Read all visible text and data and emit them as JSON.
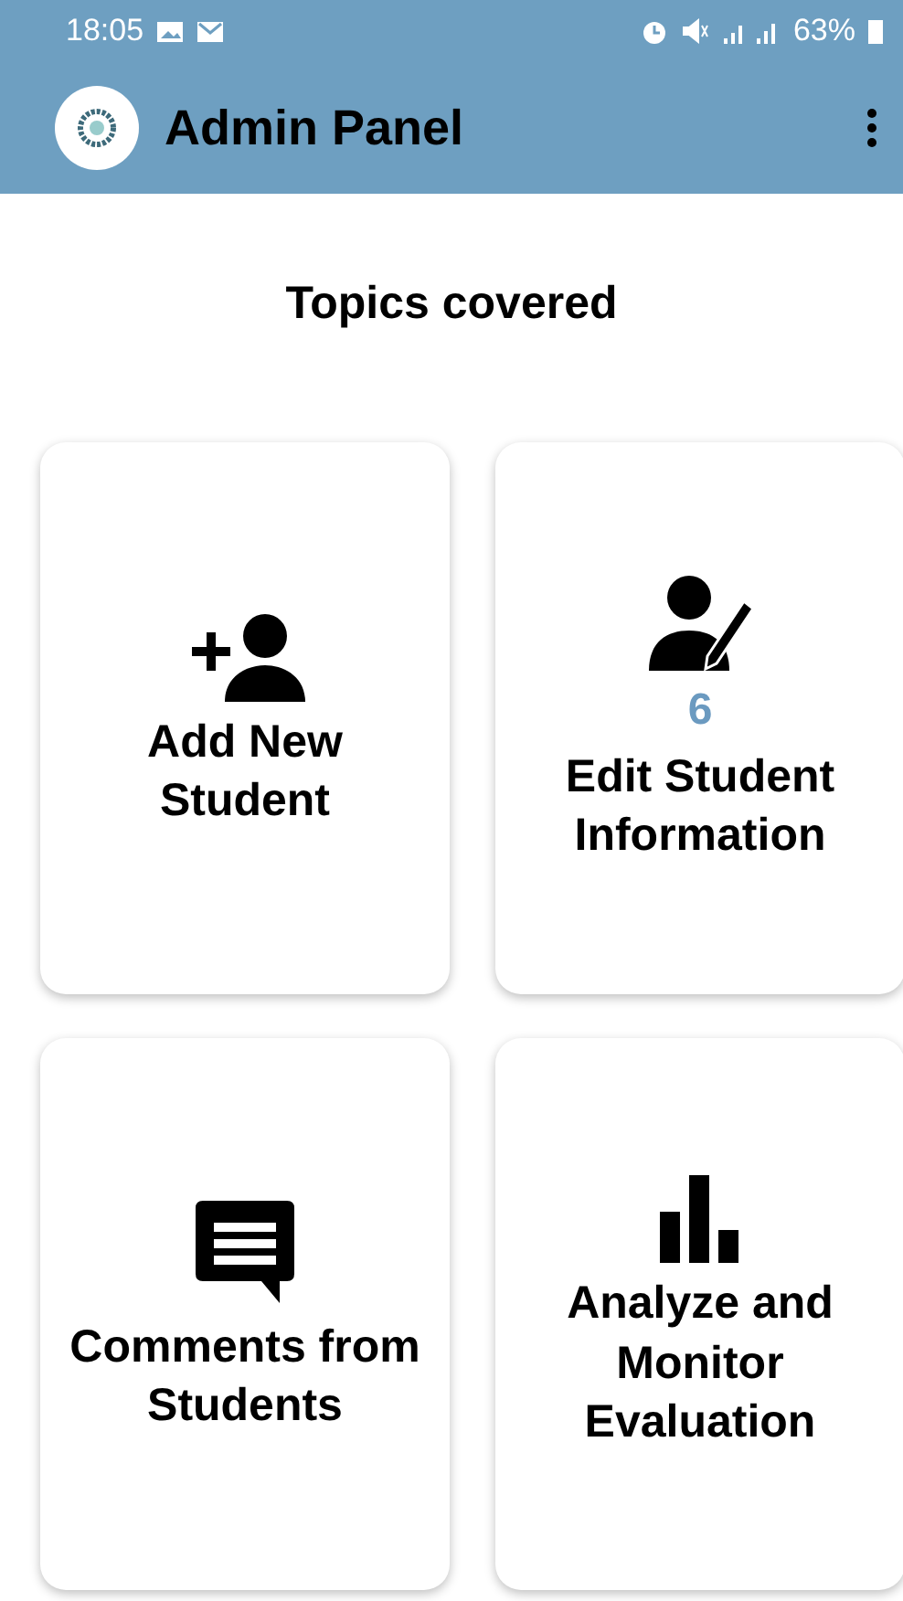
{
  "status_bar": {
    "time": "18:05",
    "battery": "63%"
  },
  "app_bar": {
    "title": "Admin Panel"
  },
  "heading": "Topics covered",
  "cards": [
    {
      "kind": "add-person",
      "label": "Add New Student"
    },
    {
      "kind": "edit-person",
      "badge": "6",
      "label": "Edit Student Information"
    },
    {
      "kind": "comment",
      "label": "Comments from Students"
    },
    {
      "kind": "chart",
      "label": "Analyze and Monitor Evaluation"
    }
  ]
}
